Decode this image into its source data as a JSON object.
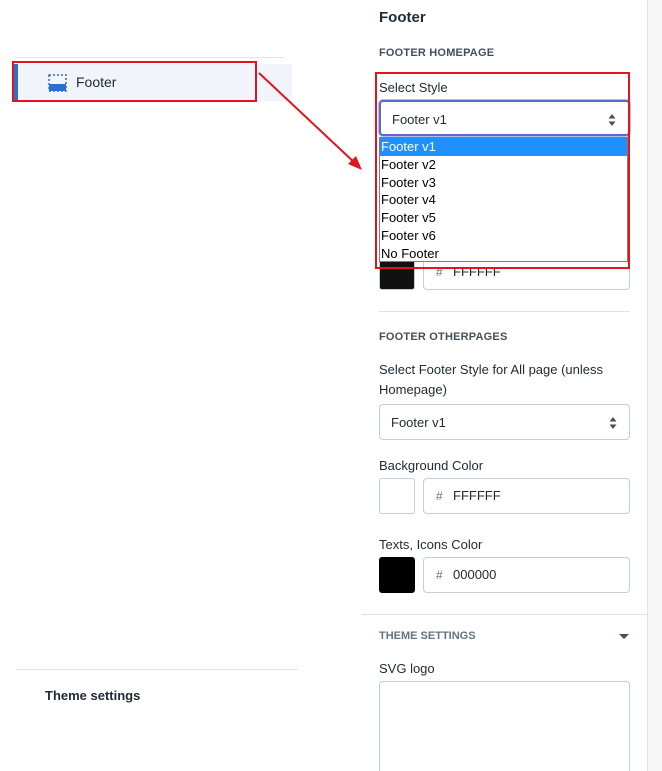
{
  "sidebar": {
    "active_item": {
      "label": "Footer",
      "icon": "footer-layout-icon"
    },
    "bottom_link": "Theme settings"
  },
  "panel": {
    "title": "Footer",
    "homepage": {
      "heading": "FOOTER HOMEPAGE",
      "select_label": "Select Style",
      "select_value": "Footer v1",
      "options": [
        "Footer v1",
        "Footer v2",
        "Footer v3",
        "Footer v4",
        "Footer v5",
        "Footer v6",
        "No Footer"
      ],
      "selected_option_index": 0,
      "hidden_color_value": "FFFFFF"
    },
    "otherpages": {
      "heading": "FOOTER OTHERPAGES",
      "select_label": "Select Footer Style for All page (unless Homepage)",
      "select_value": "Footer v1",
      "background_color_label": "Background Color",
      "background_color_value": "FFFFFF",
      "text_color_label": "Texts, Icons Color",
      "text_color_value": "000000"
    },
    "theme_settings": {
      "heading": "THEME SETTINGS",
      "svg_logo_label": "SVG logo"
    }
  },
  "colors": {
    "accent": "#2c6ecb",
    "annotation": "#e3141b",
    "selected_option": "#1e90ff",
    "homepage_swatch": "#111111",
    "background_swatch": "#ffffff",
    "text_swatch": "#000000"
  },
  "hash_symbol": "#"
}
